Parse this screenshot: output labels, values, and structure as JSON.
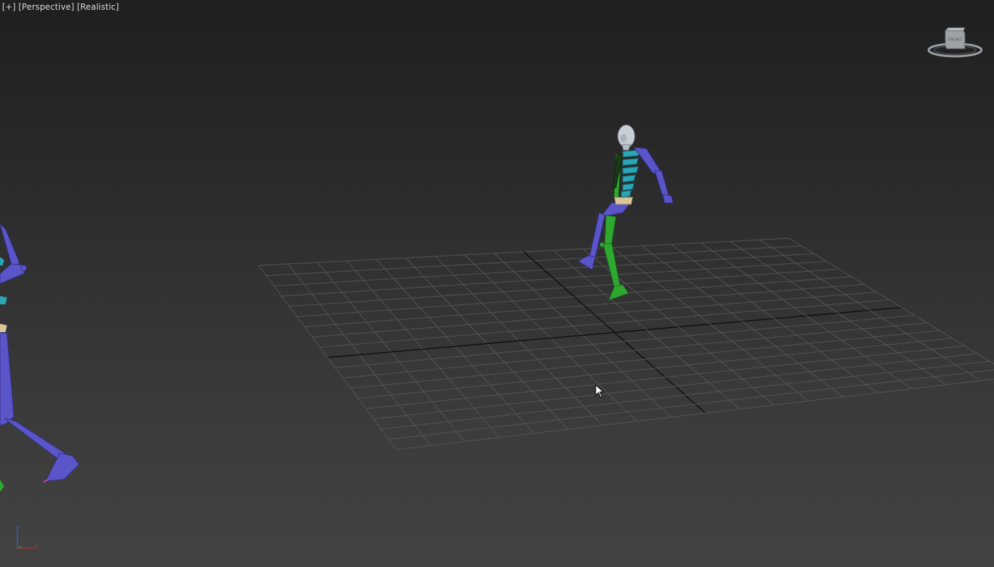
{
  "viewport": {
    "menu_label": "[+]",
    "view_label": "[Perspective]",
    "shading_label": "[Realistic]"
  },
  "viewcube": {
    "face_label": "FRONT"
  },
  "axes": {
    "x": "x",
    "y": "y",
    "z": "z"
  },
  "colors": {
    "grid": "#555555",
    "grid_axis": "#0a0a0a",
    "bone_blue": "#5a55c8",
    "bone_green": "#2fa830",
    "spine_cyan": "#2aa5b5",
    "head": "#c8cfd6",
    "pelvis": "#d8c79a"
  }
}
